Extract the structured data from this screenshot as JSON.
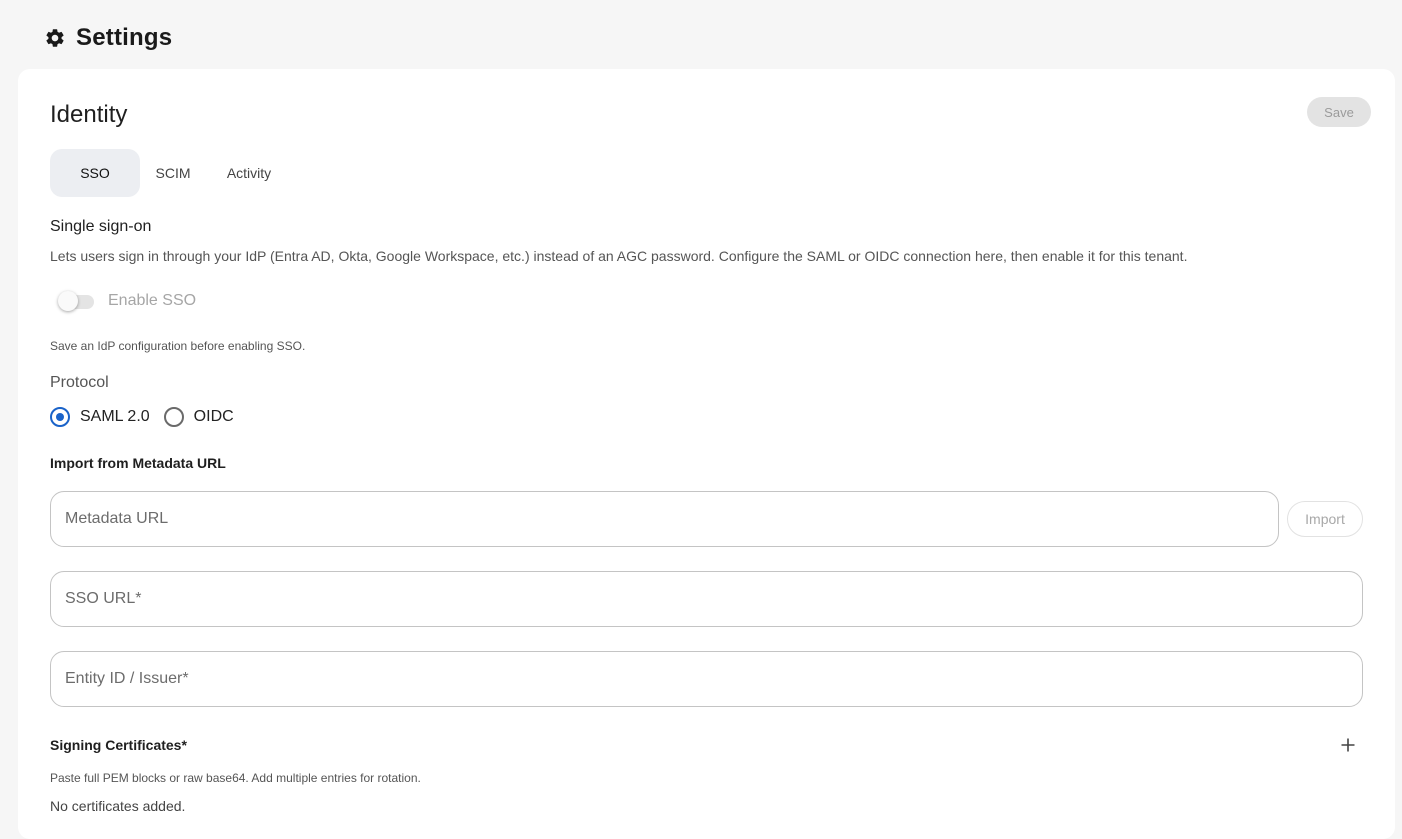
{
  "header": {
    "title": "Settings",
    "icon": "gear-icon"
  },
  "card": {
    "title": "Identity",
    "save_label": "Save"
  },
  "tabs": [
    {
      "label": "SSO",
      "active": true
    },
    {
      "label": "SCIM",
      "active": false
    },
    {
      "label": "Activity",
      "active": false
    }
  ],
  "sso": {
    "title": "Single sign-on",
    "description": "Lets users sign in through your IdP (Entra AD, Okta, Google Workspace, etc.) instead of an AGC password. Configure the SAML or OIDC connection here, then enable it for this tenant.",
    "toggle_label": "Enable SSO",
    "toggle_on": false,
    "toggle_helper": "Save an IdP configuration before enabling SSO.",
    "protocol_label": "Protocol",
    "protocol_options": [
      {
        "label": "SAML 2.0",
        "selected": true
      },
      {
        "label": "OIDC",
        "selected": false
      }
    ],
    "import_title": "Import from Metadata URL",
    "metadata_placeholder": "Metadata URL",
    "import_label": "Import",
    "sso_url_placeholder": "SSO URL*",
    "entity_id_placeholder": "Entity ID / Issuer*",
    "certificates_title": "Signing Certificates*",
    "certificates_description": "Paste full PEM blocks or raw base64. Add multiple entries for rotation.",
    "certificates_empty": "No certificates added."
  },
  "colors": {
    "accent": "#1a63c9",
    "background": "#f6f6f6",
    "card": "#ffffff",
    "tab_active_bg": "#eceef2"
  }
}
